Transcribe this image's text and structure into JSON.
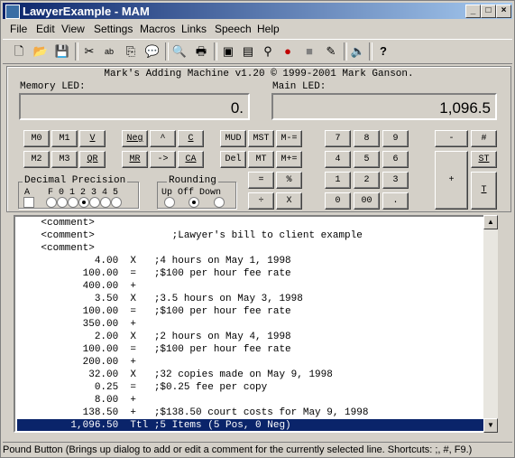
{
  "window": {
    "title": "LawyerExample - MAM"
  },
  "menu": [
    "File",
    "Edit",
    "View",
    "Settings",
    "Macros",
    "Links",
    "Speech",
    "Help"
  ],
  "machine": {
    "title": "Mark's Adding Machine v1.20 © 1999-2001 Mark Ganson."
  },
  "memory_led": {
    "label": "Memory LED:",
    "value": "0."
  },
  "main_led": {
    "label": "Main LED:",
    "value": "1,096.5"
  },
  "buttons": {
    "m0": "M0",
    "m1": "M1",
    "v": "V",
    "m2": "M2",
    "m3": "M3",
    "qr": "QR",
    "neg": "Neg",
    "up": "^",
    "c": "C",
    "mr": "MR",
    "arrow": "->",
    "ca": "CA",
    "mud": "MUD",
    "mst": "MST",
    "m_minus": "M-=",
    "del": "Del",
    "mt": "MT",
    "m_plus": "M+=",
    "eq": "=",
    "pct": "%",
    "div": "÷",
    "mul": "X",
    "k7": "7",
    "k8": "8",
    "k9": "9",
    "k4": "4",
    "k5": "5",
    "k6": "6",
    "k1": "1",
    "k2": "2",
    "k3": "3",
    "k0": "0",
    "k00": "00",
    "dot": ".",
    "minus": "-",
    "plus": "+",
    "pound": "#",
    "st": "ST",
    "t": "T"
  },
  "decimal": {
    "label": "Decimal Precision",
    "a": "A",
    "digits": "F 0 1 2 3 4 5"
  },
  "rounding": {
    "label": "Rounding",
    "options": "Up Off Down"
  },
  "tape": [
    "    <comment>",
    "    <comment>             ;Lawyer's bill to client example",
    "    <comment>",
    "             4.00  X   ;4 hours on May 1, 1998",
    "           100.00  =   ;$100 per hour fee rate",
    "           400.00  +",
    "             3.50  X   ;3.5 hours on May 3, 1998",
    "           100.00  =   ;$100 per hour fee rate",
    "           350.00  +",
    "             2.00  X   ;2 hours on May 4, 1998",
    "           100.00  =   ;$100 per hour fee rate",
    "           200.00  +",
    "            32.00  X   ;32 copies made on May 9, 1998",
    "             0.25  =   ;$0.25 fee per copy",
    "             8.00  +",
    "           138.50  +   ;$138.50 court costs for May 9, 1998",
    "         1,096.50  Ttl ;5 Items (5 Pos, 0 Neg)"
  ],
  "status": "Pound Button (Brings up dialog to add or edit a comment for the currently selected line.  Shortcuts: ;, #, F9.)"
}
